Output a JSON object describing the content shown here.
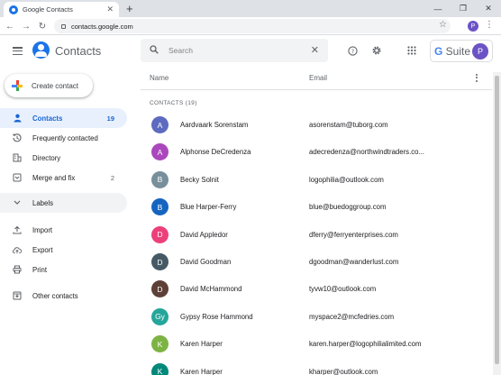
{
  "browser": {
    "tab_title": "Google Contacts",
    "url": "contacts.google.com",
    "profile_initial": "P"
  },
  "app": {
    "title": "Contacts",
    "search_placeholder": "Search",
    "gsuite_label_g": "G",
    "gsuite_label_rest": " Suite",
    "avatar_initial": "P"
  },
  "sidebar": {
    "create_label": "Create contact",
    "items": [
      {
        "label": "Contacts",
        "count": "19",
        "icon": "person-icon",
        "active": true
      },
      {
        "label": "Frequently contacted",
        "count": "",
        "icon": "history-icon"
      },
      {
        "label": "Directory",
        "count": "",
        "icon": "directory-icon"
      },
      {
        "label": "Merge and fix",
        "count": "2",
        "icon": "merge-icon"
      },
      {
        "label": "Labels",
        "count": "",
        "icon": "chevron-down-icon",
        "section": true
      },
      {
        "label": "Import",
        "count": "",
        "icon": "upload-icon"
      },
      {
        "label": "Export",
        "count": "",
        "icon": "cloud-upload-icon"
      },
      {
        "label": "Print",
        "count": "",
        "icon": "print-icon"
      },
      {
        "label": "Other contacts",
        "count": "",
        "icon": "archive-icon"
      }
    ]
  },
  "list": {
    "col_name": "Name",
    "col_email": "Email",
    "group_label": "CONTACTS (19)",
    "rows": [
      {
        "initial": "A",
        "color": "#5c6bc0",
        "name": "Aardvaark Sorenstam",
        "email": "asorenstam@tuborg.com"
      },
      {
        "initial": "A",
        "color": "#ab47bc",
        "name": "Alphonse DeCredenza",
        "email": "adecredenza@northwindtraders.co..."
      },
      {
        "initial": "B",
        "color": "#78909c",
        "name": "Becky Solnit",
        "email": "logophilia@outlook.com"
      },
      {
        "initial": "B",
        "color": "#1565c0",
        "name": "Blue Harper-Ferry",
        "email": "blue@buedoggroup.com"
      },
      {
        "initial": "D",
        "color": "#ec407a",
        "name": "David Appledor",
        "email": "dferry@ferryenterprises.com"
      },
      {
        "initial": "D",
        "color": "#455a64",
        "name": "David Goodman",
        "email": "dgoodman@wanderlust.com"
      },
      {
        "initial": "D",
        "color": "#5d4037",
        "name": "David McHammond",
        "email": "tyvw10@outlook.com"
      },
      {
        "initial": "Gy",
        "color": "#26a69a",
        "name": "Gypsy Rose Hammond",
        "email": "myspace2@mcfedries.com"
      },
      {
        "initial": "K",
        "color": "#7cb342",
        "name": "Karen Harper",
        "email": "karen.harper@logophilialimited.com"
      },
      {
        "initial": "K",
        "color": "#00897b",
        "name": "Karen Harper",
        "email": "kharper@outlook.com"
      }
    ]
  }
}
